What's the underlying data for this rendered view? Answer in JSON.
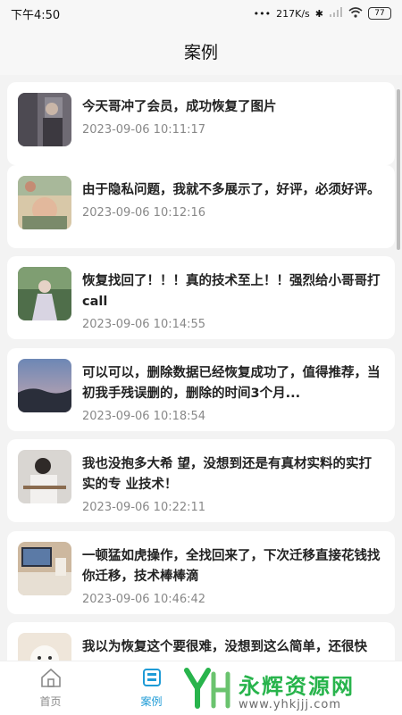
{
  "status_bar": {
    "time": "下午4:50",
    "speed": "217K/s",
    "battery": "77"
  },
  "header": {
    "title": "案例"
  },
  "cases": [
    {
      "title": "今天哥冲了会员，成功恢复了图片",
      "time": "2023-09-06 10:11:17"
    },
    {
      "title": "由于隐私问题，我就不多展示了，好评，必须好评。",
      "time": "2023-09-06 10:12:16"
    },
    {
      "title": "恢复找回了！！！真的技术至上！！强烈给小哥哥打call",
      "time": "2023-09-06 10:14:55"
    },
    {
      "title": "可以可以，删除数据已经恢复成功了，值得推荐，当初我手残误删的，删除的时间3个月...",
      "time": "2023-09-06 10:18:54"
    },
    {
      "title": "我也没抱多大希 望，没想到还是有真材实料的实打实的专 业技术！",
      "time": "2023-09-06 10:22:11"
    },
    {
      "title": "一顿猛如虎操作，全找回来了，下次迁移直接花钱找你迁移，技术棒棒滴",
      "time": "2023-09-06 10:46:42"
    },
    {
      "title": "我以为恢复这个要很难，没想到这么简单，还很快",
      "time": ""
    }
  ],
  "tabs": [
    {
      "label": "首页"
    },
    {
      "label": "案例"
    }
  ],
  "watermark": {
    "text": "永辉资源网",
    "url": "www.yhkjjj.com"
  },
  "colors": {
    "accent": "#1f9bd6",
    "watermark_green": "#28b44c"
  }
}
